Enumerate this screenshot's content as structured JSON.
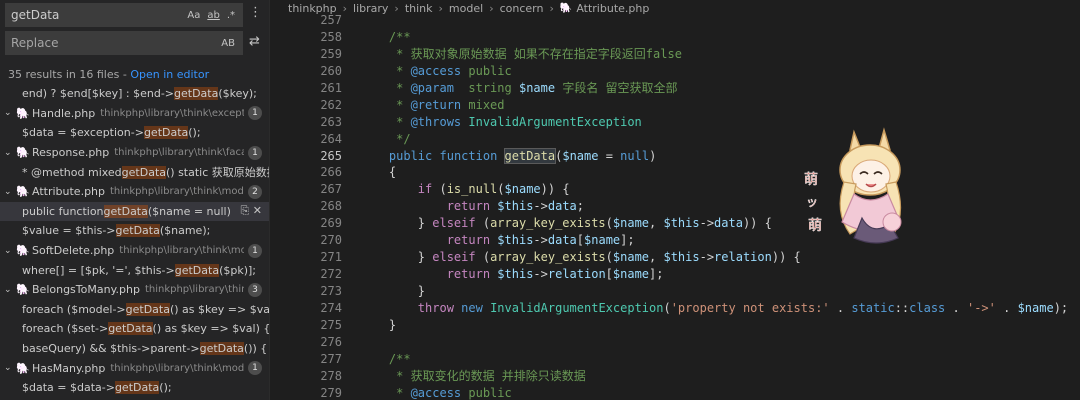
{
  "search": {
    "query": "getData",
    "replace_placeholder": "Replace",
    "opt_case": "Aa",
    "opt_word": "ab",
    "opt_regex": ".*",
    "opt_preserve_case": "AB",
    "summary": "35 results in 16 files - ",
    "open_in_editor": "Open in editor"
  },
  "results": [
    {
      "kind": "match",
      "pre": "end) ? $end[$key] : $end->",
      "hit": "getData",
      "post": "($key);"
    },
    {
      "kind": "file",
      "name": "Handle.php",
      "path": "thinkphp\\library\\think\\excepti...",
      "count": "1"
    },
    {
      "kind": "match",
      "pre": "$data = $exception->",
      "hit": "getData",
      "post": "();"
    },
    {
      "kind": "file",
      "name": "Response.php",
      "path": "thinkphp\\library\\think\\facade",
      "count": "1"
    },
    {
      "kind": "match",
      "pre": "* @method mixed ",
      "hit": "getData",
      "post": "() static 获取原始数据"
    },
    {
      "kind": "file",
      "name": "Attribute.php",
      "path": "thinkphp\\library\\think\\mod...",
      "count": "2"
    },
    {
      "kind": "match",
      "pre": "public function ",
      "hit": "getData",
      "post": "($name = null)",
      "selected": true
    },
    {
      "kind": "match",
      "pre": "$value    = $this->",
      "hit": "getData",
      "post": "($name);"
    },
    {
      "kind": "file",
      "name": "SoftDelete.php",
      "path": "thinkphp\\library\\think\\mo...",
      "count": "1"
    },
    {
      "kind": "match",
      "pre": "where[] = [$pk, '=', $this->",
      "hit": "getData",
      "post": "($pk)];"
    },
    {
      "kind": "file",
      "name": "BelongsToMany.php",
      "path": "thinkphp\\library\\thin...",
      "count": "3"
    },
    {
      "kind": "match",
      "pre": "foreach ($model->",
      "hit": "getData",
      "post": "() as $key => $val) {"
    },
    {
      "kind": "match",
      "pre": "foreach ($set->",
      "hit": "getData",
      "post": "() as $key => $val) {"
    },
    {
      "kind": "match",
      "pre": "baseQuery) && $this->parent->",
      "hit": "getData",
      "post": "()) {"
    },
    {
      "kind": "file",
      "name": "HasMany.php",
      "path": "thinkphp\\library\\think\\mod...",
      "count": "1"
    },
    {
      "kind": "match",
      "pre": "$data = $data->",
      "hit": "getData",
      "post": "();"
    }
  ],
  "breadcrumb": [
    "thinkphp",
    "library",
    "think",
    "model",
    "concern",
    "Attribute.php"
  ],
  "current_line": 265,
  "code": [
    {
      "n": 257,
      "t": []
    },
    {
      "n": 258,
      "t": [
        [
          "    ",
          "txt"
        ],
        [
          "/**",
          "com"
        ]
      ]
    },
    {
      "n": 259,
      "t": [
        [
          "     ",
          "txt"
        ],
        [
          "* 获取对象原始数据 如果不存在指定字段返回false",
          "com"
        ]
      ]
    },
    {
      "n": 260,
      "t": [
        [
          "     ",
          "txt"
        ],
        [
          "* ",
          "com"
        ],
        [
          "@access",
          "tag"
        ],
        [
          " public",
          "com"
        ]
      ]
    },
    {
      "n": 261,
      "t": [
        [
          "     ",
          "txt"
        ],
        [
          "* ",
          "com"
        ],
        [
          "@param",
          "tag"
        ],
        [
          "  string ",
          "com"
        ],
        [
          "$name",
          "var"
        ],
        [
          " 字段名 留空获取全部",
          "com"
        ]
      ]
    },
    {
      "n": 262,
      "t": [
        [
          "     ",
          "txt"
        ],
        [
          "* ",
          "com"
        ],
        [
          "@return",
          "tag"
        ],
        [
          " mixed",
          "com"
        ]
      ]
    },
    {
      "n": 263,
      "t": [
        [
          "     ",
          "txt"
        ],
        [
          "* ",
          "com"
        ],
        [
          "@throws",
          "tag"
        ],
        [
          " InvalidArgumentException",
          "type"
        ]
      ]
    },
    {
      "n": 264,
      "t": [
        [
          "     ",
          "txt"
        ],
        [
          "*/",
          "com"
        ]
      ]
    },
    {
      "n": 265,
      "t": [
        [
          "    ",
          "txt"
        ],
        [
          "public",
          "kw"
        ],
        [
          " ",
          "txt"
        ],
        [
          "function",
          "kw"
        ],
        [
          " ",
          "txt"
        ],
        [
          "getData",
          "fnhl"
        ],
        [
          "(",
          "txt"
        ],
        [
          "$name",
          "var"
        ],
        [
          " = ",
          "txt"
        ],
        [
          "null",
          "kw"
        ],
        [
          ")",
          "txt"
        ]
      ]
    },
    {
      "n": 266,
      "t": [
        [
          "    {",
          "txt"
        ]
      ]
    },
    {
      "n": 267,
      "t": [
        [
          "        ",
          "txt"
        ],
        [
          "if",
          "ctl"
        ],
        [
          " (",
          "txt"
        ],
        [
          "is_null",
          "fn"
        ],
        [
          "(",
          "txt"
        ],
        [
          "$name",
          "var"
        ],
        [
          ")) {",
          "txt"
        ]
      ]
    },
    {
      "n": 268,
      "t": [
        [
          "            ",
          "txt"
        ],
        [
          "return",
          "ctl"
        ],
        [
          " ",
          "txt"
        ],
        [
          "$this",
          "var"
        ],
        [
          "->",
          "txt"
        ],
        [
          "data",
          "var"
        ],
        [
          ";",
          "txt"
        ]
      ]
    },
    {
      "n": 269,
      "t": [
        [
          "        } ",
          "txt"
        ],
        [
          "elseif",
          "ctl"
        ],
        [
          " (",
          "txt"
        ],
        [
          "array_key_exists",
          "fn"
        ],
        [
          "(",
          "txt"
        ],
        [
          "$name",
          "var"
        ],
        [
          ", ",
          "txt"
        ],
        [
          "$this",
          "var"
        ],
        [
          "->",
          "txt"
        ],
        [
          "data",
          "var"
        ],
        [
          ")) {",
          "txt"
        ]
      ]
    },
    {
      "n": 270,
      "t": [
        [
          "            ",
          "txt"
        ],
        [
          "return",
          "ctl"
        ],
        [
          " ",
          "txt"
        ],
        [
          "$this",
          "var"
        ],
        [
          "->",
          "txt"
        ],
        [
          "data",
          "var"
        ],
        [
          "[",
          "txt"
        ],
        [
          "$name",
          "var"
        ],
        [
          "];",
          "txt"
        ]
      ]
    },
    {
      "n": 271,
      "t": [
        [
          "        } ",
          "txt"
        ],
        [
          "elseif",
          "ctl"
        ],
        [
          " (",
          "txt"
        ],
        [
          "array_key_exists",
          "fn"
        ],
        [
          "(",
          "txt"
        ],
        [
          "$name",
          "var"
        ],
        [
          ", ",
          "txt"
        ],
        [
          "$this",
          "var"
        ],
        [
          "->",
          "txt"
        ],
        [
          "relation",
          "var"
        ],
        [
          ")) {",
          "txt"
        ]
      ]
    },
    {
      "n": 272,
      "t": [
        [
          "            ",
          "txt"
        ],
        [
          "return",
          "ctl"
        ],
        [
          " ",
          "txt"
        ],
        [
          "$this",
          "var"
        ],
        [
          "->",
          "txt"
        ],
        [
          "relation",
          "var"
        ],
        [
          "[",
          "txt"
        ],
        [
          "$name",
          "var"
        ],
        [
          "];",
          "txt"
        ]
      ]
    },
    {
      "n": 273,
      "t": [
        [
          "        }",
          "txt"
        ]
      ]
    },
    {
      "n": 274,
      "t": [
        [
          "        ",
          "txt"
        ],
        [
          "throw",
          "ctl"
        ],
        [
          " ",
          "txt"
        ],
        [
          "new",
          "kw"
        ],
        [
          " ",
          "txt"
        ],
        [
          "InvalidArgumentException",
          "cls"
        ],
        [
          "(",
          "txt"
        ],
        [
          "'property not exists:'",
          "str"
        ],
        [
          " . ",
          "txt"
        ],
        [
          "static",
          "kw"
        ],
        [
          "::",
          "txt"
        ],
        [
          "class",
          "kw"
        ],
        [
          " . ",
          "txt"
        ],
        [
          "'->'",
          "str"
        ],
        [
          " . ",
          "txt"
        ],
        [
          "$name",
          "var"
        ],
        [
          ");",
          "txt"
        ]
      ]
    },
    {
      "n": 275,
      "t": [
        [
          "    }",
          "txt"
        ]
      ]
    },
    {
      "n": 276,
      "t": []
    },
    {
      "n": 277,
      "t": [
        [
          "    ",
          "txt"
        ],
        [
          "/**",
          "com"
        ]
      ]
    },
    {
      "n": 278,
      "t": [
        [
          "     ",
          "txt"
        ],
        [
          "* 获取变化的数据 并排除只读数据",
          "com"
        ]
      ]
    },
    {
      "n": 279,
      "t": [
        [
          "     ",
          "txt"
        ],
        [
          "* ",
          "com"
        ],
        [
          "@access",
          "tag"
        ],
        [
          " public",
          "com"
        ]
      ]
    }
  ],
  "sticker_text": [
    "萌",
    "ッ",
    "萌"
  ],
  "colors": {
    "highlight": "#ea5c00",
    "link": "#3794ff",
    "php_icon": "#a074c4"
  }
}
